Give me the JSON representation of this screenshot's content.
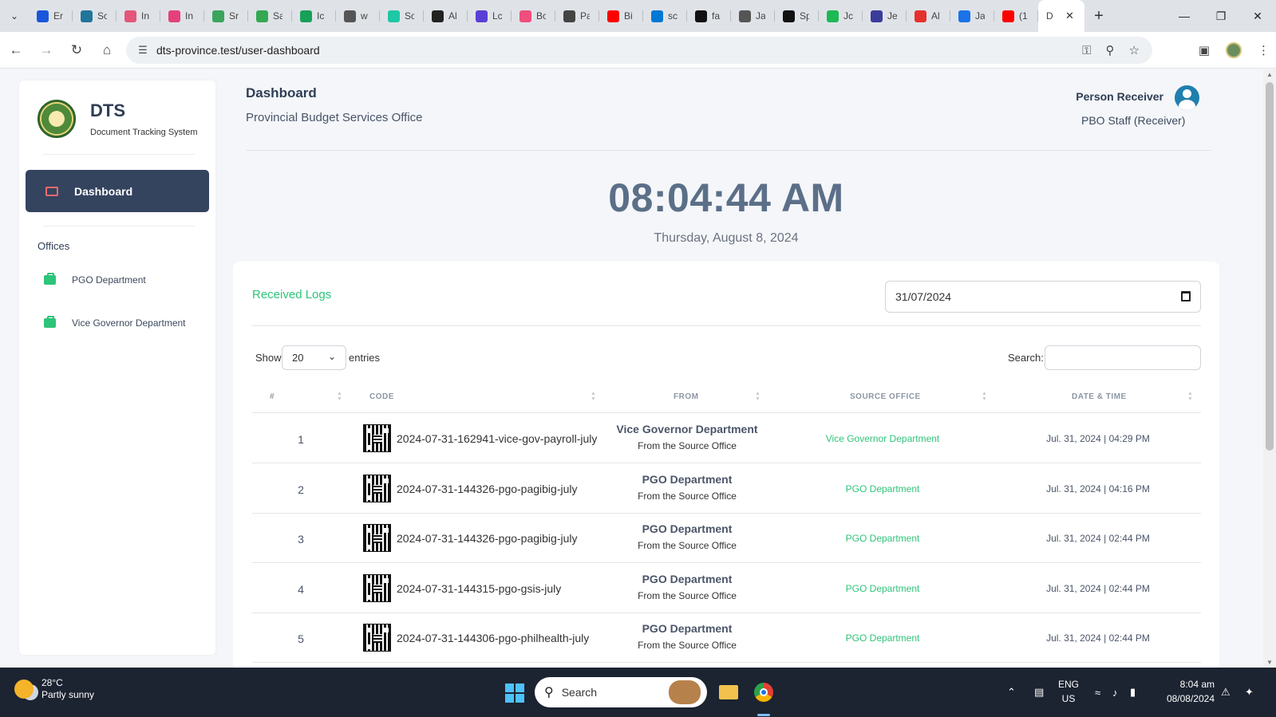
{
  "browser": {
    "tabs": [
      {
        "label": "Er",
        "color": "#1a56db"
      },
      {
        "label": "Sc",
        "color": "#21759b"
      },
      {
        "label": "In",
        "color": "#e4567a"
      },
      {
        "label": "In",
        "color": "#e4407a"
      },
      {
        "label": "Sr",
        "color": "#3ba55c"
      },
      {
        "label": "Sa",
        "color": "#34a853"
      },
      {
        "label": "Ic",
        "color": "#18a058"
      },
      {
        "label": "w",
        "color": "#555555"
      },
      {
        "label": "Sc",
        "color": "#1ec8a5"
      },
      {
        "label": "Al",
        "color": "#222222"
      },
      {
        "label": "Lc",
        "color": "#5a3fd6"
      },
      {
        "label": "Bc",
        "color": "#f04e7c"
      },
      {
        "label": "Pa",
        "color": "#444444"
      },
      {
        "label": "Bi",
        "color": "#ff0000"
      },
      {
        "label": "sc",
        "color": "#0078d4"
      },
      {
        "label": "fa",
        "color": "#111111"
      },
      {
        "label": "Ja",
        "color": "#555555"
      },
      {
        "label": "Sp",
        "color": "#111111"
      },
      {
        "label": "Jc",
        "color": "#1db954"
      },
      {
        "label": "Je",
        "color": "#3b3b9a"
      },
      {
        "label": "Al",
        "color": "#e5322d"
      },
      {
        "label": "Ja",
        "color": "#1a73e8"
      },
      {
        "label": "(1",
        "color": "#ff0000"
      }
    ],
    "active_tab": "D",
    "url": "dts-province.test/user-dashboard"
  },
  "sidebar": {
    "brand_name": "DTS",
    "brand_sub": "Document Tracking System",
    "active_item": "Dashboard",
    "offices_heading": "Offices",
    "offices": [
      "PGO Department",
      "Vice Governor Department"
    ]
  },
  "header": {
    "title": "Dashboard",
    "subtitle": "Provincial Budget Services Office",
    "user_name": "Person Receiver",
    "user_role": "PBO Staff (Receiver)"
  },
  "clock": {
    "time": "08:04:44 AM",
    "date": "Thursday, August 8, 2024"
  },
  "logs": {
    "title": "Received Logs",
    "filter_date": "31/07/2024",
    "show_label": "Show",
    "entries_value": "20",
    "entries_label": "entries",
    "search_label": "Search:",
    "columns": [
      "#",
      "CODE",
      "FROM",
      "SOURCE OFFICE",
      "DATE & TIME"
    ],
    "rows": [
      {
        "num": "1",
        "code": "2024-07-31-162941-vice-gov-payroll-july",
        "from": "Vice Governor Department",
        "from_sub": "From the Source Office",
        "source": "Vice Governor Department",
        "datetime": "Jul. 31, 2024 | 04:29 PM"
      },
      {
        "num": "2",
        "code": "2024-07-31-144326-pgo-pagibig-july",
        "from": "PGO Department",
        "from_sub": "From the Source Office",
        "source": "PGO Department",
        "datetime": "Jul. 31, 2024 | 04:16 PM"
      },
      {
        "num": "3",
        "code": "2024-07-31-144326-pgo-pagibig-july",
        "from": "PGO Department",
        "from_sub": "From the Source Office",
        "source": "PGO Department",
        "datetime": "Jul. 31, 2024 | 02:44 PM"
      },
      {
        "num": "4",
        "code": "2024-07-31-144315-pgo-gsis-july",
        "from": "PGO Department",
        "from_sub": "From the Source Office",
        "source": "PGO Department",
        "datetime": "Jul. 31, 2024 | 02:44 PM"
      },
      {
        "num": "5",
        "code": "2024-07-31-144306-pgo-philhealth-july",
        "from": "PGO Department",
        "from_sub": "From the Source Office",
        "source": "PGO Department",
        "datetime": "Jul. 31, 2024 | 02:44 PM"
      }
    ]
  },
  "taskbar": {
    "weather_temp": "28°C",
    "weather_desc": "Partly sunny",
    "search_placeholder": "Search",
    "lang_top": "ENG",
    "lang_bottom": "US",
    "time": "8:04 am",
    "date": "08/08/2024"
  }
}
